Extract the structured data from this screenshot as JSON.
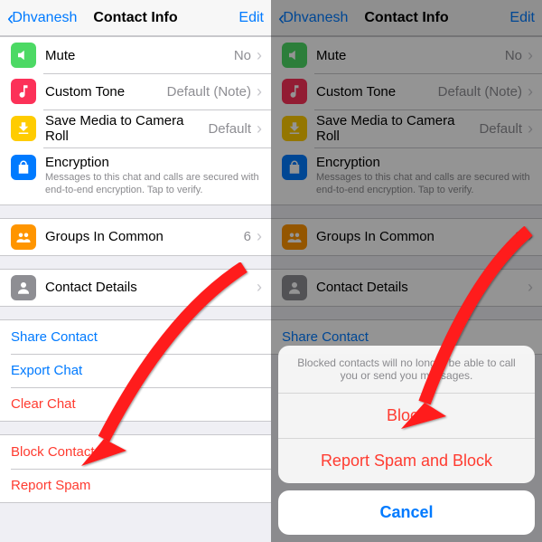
{
  "nav": {
    "back": "Dhvanesh",
    "title": "Contact Info",
    "edit": "Edit"
  },
  "icons": {
    "mute_bg": "#4cd964",
    "tone_bg": "#fc3158",
    "media_bg": "#ffcc00",
    "encrypt_bg": "#007aff",
    "groups_bg": "#ff9500",
    "details_bg": "#8e8e93"
  },
  "mute": {
    "label": "Mute",
    "value": "No"
  },
  "tone": {
    "label": "Custom Tone",
    "value": "Default (Note)"
  },
  "media": {
    "label": "Save Media to Camera Roll",
    "value": "Default"
  },
  "encrypt": {
    "label": "Encryption",
    "sub": "Messages to this chat and calls are secured with end-to-end encryption. Tap to verify."
  },
  "groups": {
    "label": "Groups In Common",
    "value": "6"
  },
  "details": {
    "label": "Contact Details"
  },
  "actions": {
    "share": "Share Contact",
    "export": "Export Chat",
    "clear": "Clear Chat",
    "block": "Block Contact",
    "report": "Report Spam"
  },
  "sheet": {
    "message": "Blocked contacts will no longer be able to call you or send you messages.",
    "block": "Block",
    "report_block": "Report Spam and Block",
    "cancel": "Cancel"
  }
}
